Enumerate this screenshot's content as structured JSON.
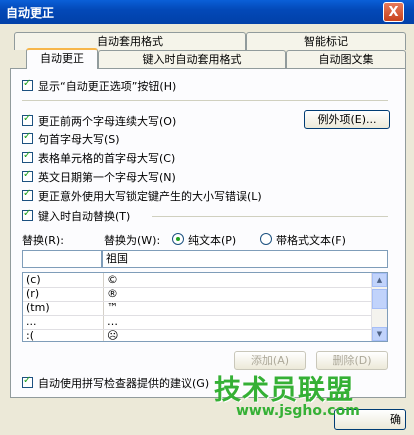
{
  "window": {
    "title": "自动更正",
    "close_label": "X"
  },
  "tabs": {
    "row1": [
      "自动套用格式",
      "智能标记"
    ],
    "row2": [
      "自动更正",
      "键入时自动套用格式",
      "自动图文集"
    ]
  },
  "options": {
    "show_buttons": "显示“自动更正选项”按钮(H)",
    "two_initial_caps": "更正前两个字母连续大写(O)",
    "cap_first_sentence": "句首字母大写(S)",
    "cap_first_table_cell": "表格单元格的首字母大写(C)",
    "cap_day_names": "英文日期第一个字母大写(N)",
    "caps_lock_fix": "更正意外使用大写锁定键产生的大小写错误(L)",
    "replace_as_type": "键入时自动替换(T)",
    "exceptions_button": "例外项(E)..."
  },
  "replace": {
    "replace_label": "替换(R):",
    "with_label": "替换为(W):",
    "plain_text": "纯文本(P)",
    "formatted_text": "带格式文本(F)",
    "replace_value": "",
    "with_value": "祖国"
  },
  "entries": [
    {
      "replace": "(c)",
      "with": "©"
    },
    {
      "replace": "(r)",
      "with": "®"
    },
    {
      "replace": "(tm)",
      "with": "™"
    },
    {
      "replace": "...",
      "with": "…"
    },
    {
      "replace": ":(",
      "with": "☹"
    }
  ],
  "buttons": {
    "add": "添加(A)",
    "delete": "删除(D)",
    "ok": "确"
  },
  "footer": {
    "spelling": "自动使用拼写检查器提供的建议(G)"
  },
  "watermark": {
    "text": "技术员联盟",
    "url": "www.jsgho.com"
  }
}
